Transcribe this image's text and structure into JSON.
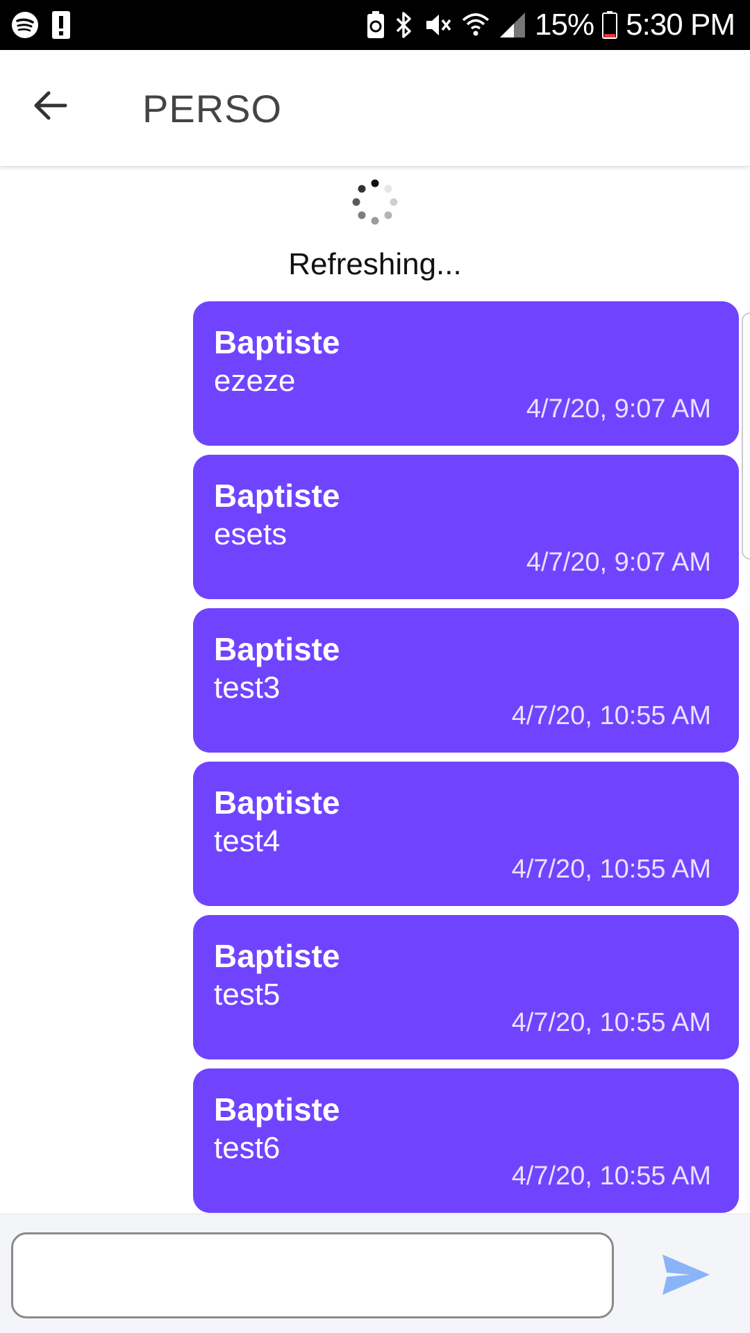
{
  "status_bar": {
    "battery_percent": "15%",
    "time": "5:30 PM",
    "icons_left": [
      "spotify-icon",
      "alert-icon"
    ],
    "icons_right": [
      "battery-saver-icon",
      "bluetooth-icon",
      "vibrate-mute-icon",
      "wifi-icon",
      "signal-icon",
      "battery-icon"
    ]
  },
  "header": {
    "title": "PERSO",
    "back_icon": "arrow-left-icon"
  },
  "refresher": {
    "text": "Refreshing..."
  },
  "messages": [
    {
      "author": "Baptiste",
      "text": "ezeze",
      "time": "4/7/20, 9:07 AM"
    },
    {
      "author": "Baptiste",
      "text": "esets",
      "time": "4/7/20, 9:07 AM"
    },
    {
      "author": "Baptiste",
      "text": "test3",
      "time": "4/7/20, 10:55 AM"
    },
    {
      "author": "Baptiste",
      "text": "test4",
      "time": "4/7/20, 10:55 AM"
    },
    {
      "author": "Baptiste",
      "text": "test5",
      "time": "4/7/20, 10:55 AM"
    },
    {
      "author": "Baptiste",
      "text": "test6",
      "time": "4/7/20, 10:55 AM"
    }
  ],
  "composer": {
    "input_value": "",
    "send_icon": "send-icon"
  },
  "colors": {
    "bubble": "#7044ff",
    "send": "#8ab4f8",
    "battery_low": "#e53935"
  }
}
